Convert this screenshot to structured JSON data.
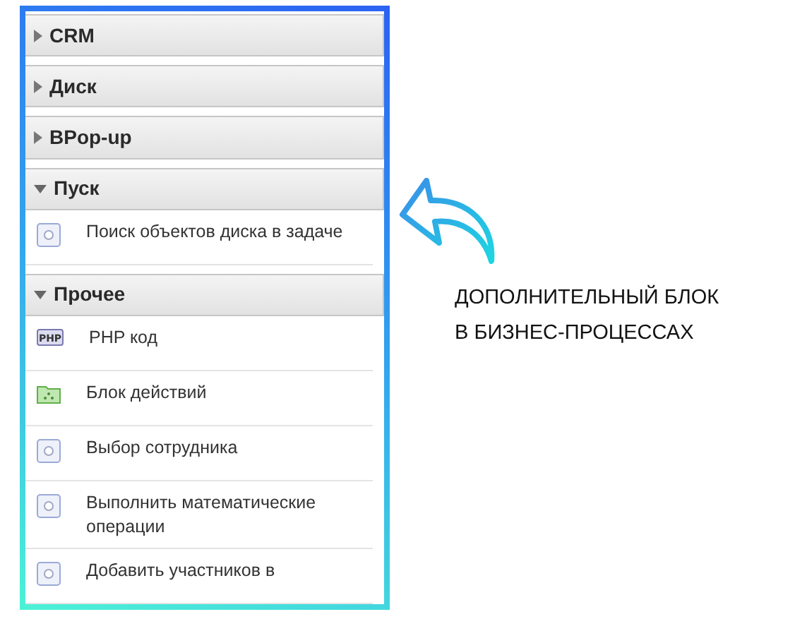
{
  "groups": [
    {
      "title": "CRM",
      "expanded": false
    },
    {
      "title": "Диск",
      "expanded": false
    },
    {
      "title": "BPop-up",
      "expanded": false
    },
    {
      "title": "Пуск",
      "expanded": true,
      "items": [
        {
          "label": "Поиск объектов диска в задаче",
          "kind": "activity"
        }
      ]
    },
    {
      "title": "Прочее",
      "expanded": true,
      "items": [
        {
          "label": "PHP код",
          "kind": "php",
          "icon_text": "PHP"
        },
        {
          "label": "Блок действий",
          "kind": "block"
        },
        {
          "label": "Выбор сотрудника",
          "kind": "activity"
        },
        {
          "label": "Выполнить математические операции",
          "kind": "activity"
        },
        {
          "label": "Добавить участников в",
          "kind": "activity"
        }
      ]
    }
  ],
  "callout": {
    "lines": [
      "ДОПОЛНИТЕЛЬНЫЙ БЛОК",
      "В БИЗНЕС-ПРОЦЕССАХ"
    ]
  }
}
